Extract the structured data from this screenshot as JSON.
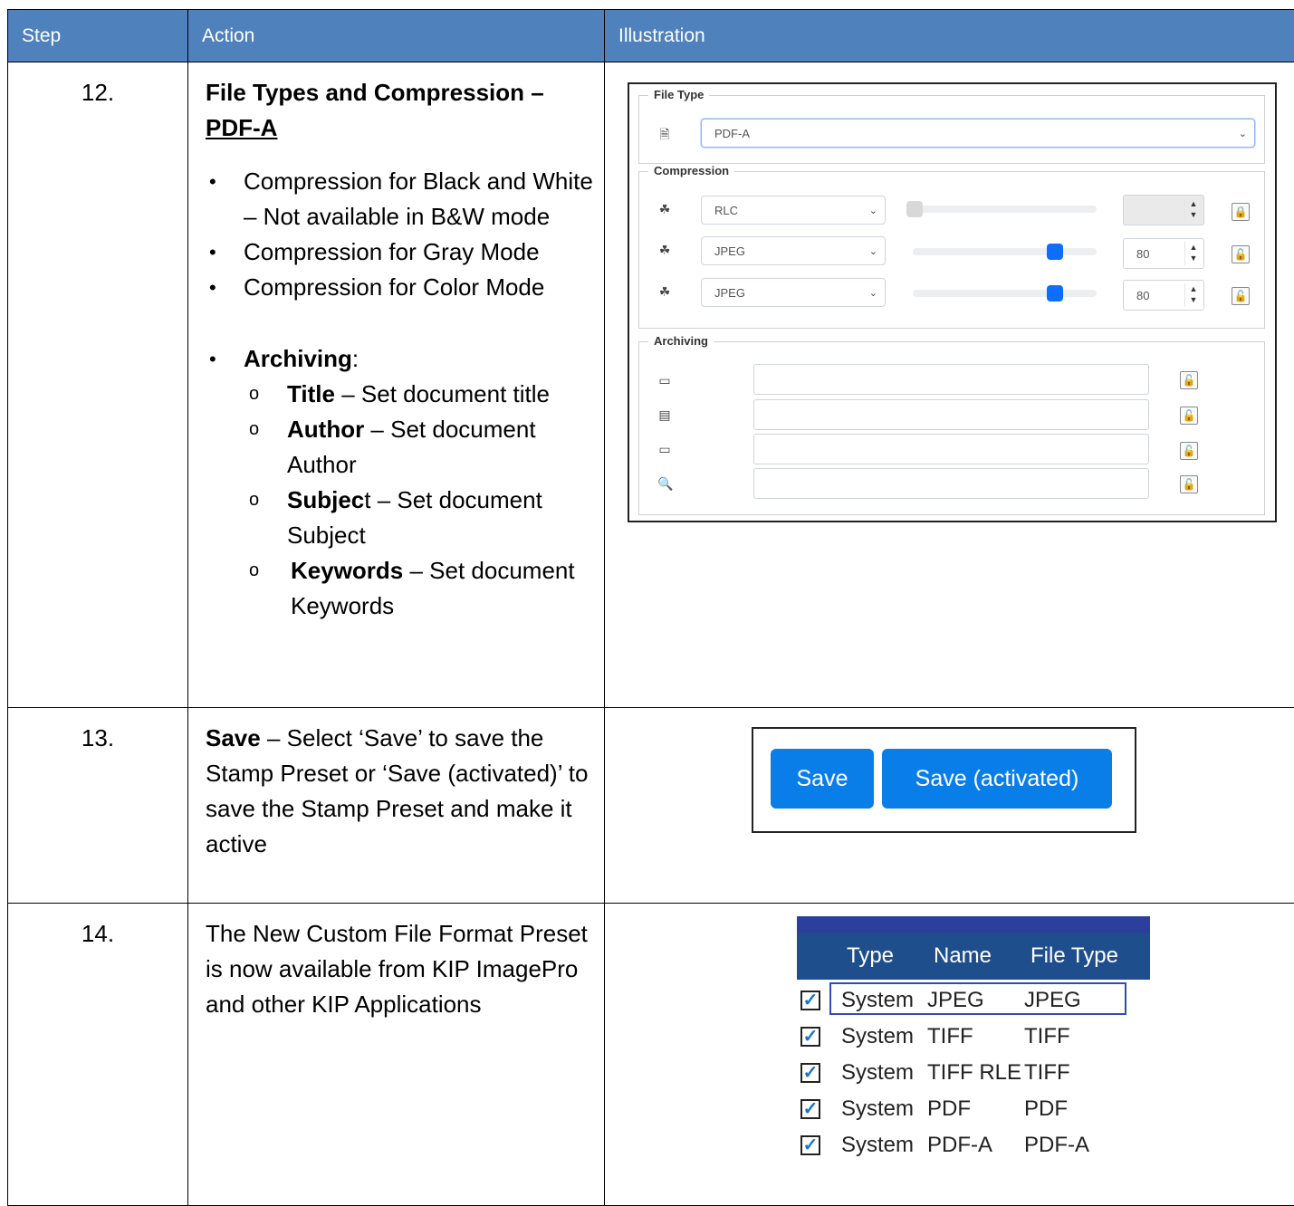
{
  "table": {
    "headers": [
      "Step",
      "Action",
      "Illustration"
    ],
    "rows": [
      {
        "step": "12.",
        "title_a": "File Types and Compression –",
        "title_b": "PDF-A",
        "bullets": [
          "Compression for Black and White – Not available in B&W mode",
          "Compression for Gray Mode",
          "Compression for Color Mode"
        ],
        "archiving_label": "Archiving",
        "archiving_colon": ":",
        "sub": [
          {
            "bold": "Title",
            "rest": " – Set document title"
          },
          {
            "bold": "Author",
            "rest": " – Set document Author"
          },
          {
            "bold": "Subjec",
            "rest": "t – Set document Subject"
          },
          {
            "bold": "Keywords",
            "rest": " – Set document Keywords"
          }
        ]
      },
      {
        "step": "13.",
        "bold": "Save",
        "rest": " – Select ‘Save’ to save the Stamp Preset or ‘Save (activated)’ to save the Stamp Preset and make it active"
      },
      {
        "step": "14.",
        "text": "The New Custom File Format Preset is now available from KIP ImagePro and other KIP Applications"
      }
    ]
  },
  "form": {
    "file_type_legend": "File Type",
    "file_type_value": "PDF-A",
    "compression_legend": "Compression",
    "compression_rows": [
      {
        "value": "RLC",
        "quality": "",
        "disabled": true,
        "level": 0.0
      },
      {
        "value": "JPEG",
        "quality": "80",
        "disabled": false,
        "level": 0.8
      },
      {
        "value": "JPEG",
        "quality": "80",
        "disabled": false,
        "level": 0.8
      }
    ],
    "archiving_legend": "Archiving",
    "archiving_fields": [
      "",
      "",
      "",
      ""
    ]
  },
  "buttons": {
    "save": "Save",
    "save_activated": "Save (activated)",
    "color": "#0a7ee8"
  },
  "presets": {
    "headers": [
      "Type",
      "Name",
      "File Type"
    ],
    "rows": [
      {
        "type": "System",
        "name": "JPEG",
        "file_type": "JPEG",
        "checked": true
      },
      {
        "type": "System",
        "name": "TIFF",
        "file_type": "TIFF",
        "checked": true
      },
      {
        "type": "System",
        "name": "TIFF RLE",
        "file_type": "TIFF",
        "checked": true
      },
      {
        "type": "System",
        "name": "PDF",
        "file_type": "PDF",
        "checked": true
      },
      {
        "type": "System",
        "name": "PDF-A",
        "file_type": "PDF-A",
        "checked": true
      }
    ],
    "header_color": "#1f4e8c"
  },
  "colors": {
    "table_header": "#4f81bd",
    "accent": "#0d6efd"
  }
}
